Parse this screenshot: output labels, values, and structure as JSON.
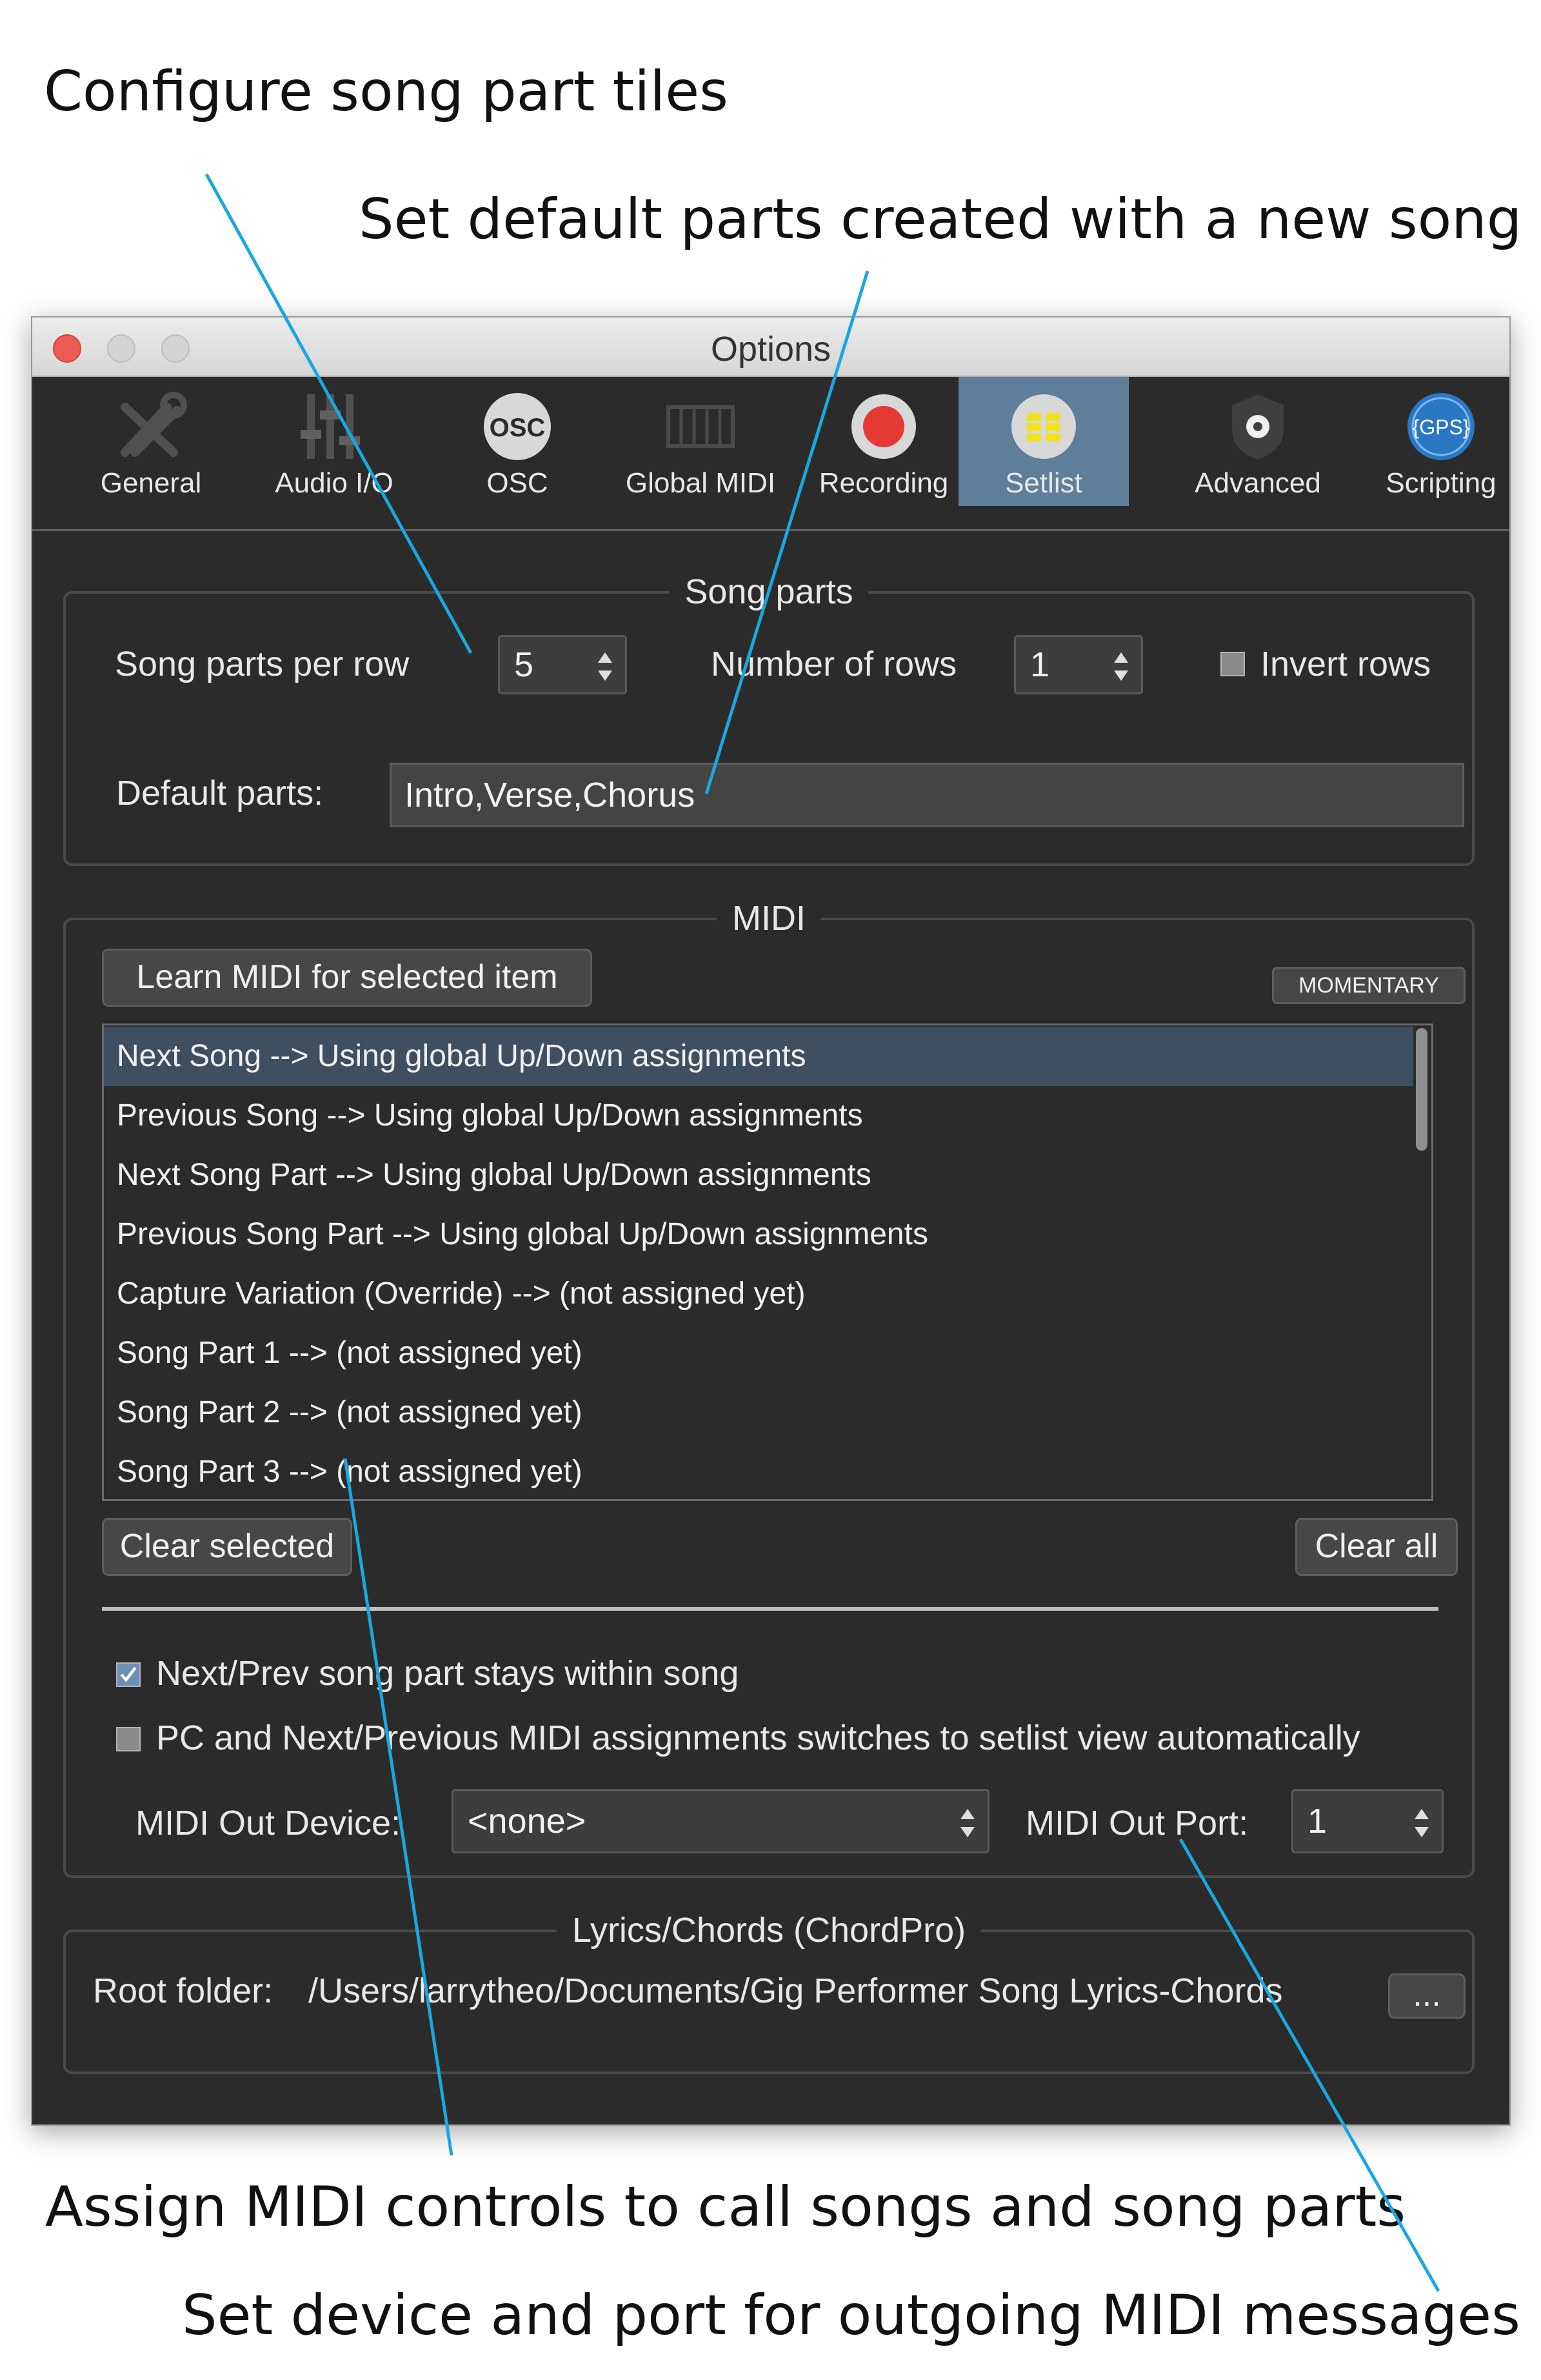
{
  "callouts": {
    "configure": "Configure song part tiles",
    "default_parts": "Set default parts created with a new song",
    "assign_midi": "Assign MIDI controls to call songs and song parts",
    "device_port": "Set device and port for outgoing MIDI messages"
  },
  "window": {
    "title": "Options"
  },
  "tabs": [
    {
      "label": "General",
      "icon": "wrench-screwdriver-icon"
    },
    {
      "label": "Audio I/O",
      "icon": "fader-sliders-icon"
    },
    {
      "label": "OSC",
      "icon": "osc-badge-icon"
    },
    {
      "label": "Global MIDI",
      "icon": "midi-keyboard-icon"
    },
    {
      "label": "Recording",
      "icon": "record-icon"
    },
    {
      "label": "Setlist",
      "icon": "setlist-icon"
    },
    {
      "label": "Advanced",
      "icon": "shield-gear-icon"
    },
    {
      "label": "Scripting",
      "icon": "gps-script-icon"
    }
  ],
  "tabs_osc_text": "OSC",
  "tabs_gps_text": "{GPS}",
  "song_parts": {
    "title": "Song parts",
    "per_row_label": "Song parts per row",
    "per_row_value": "5",
    "rows_label": "Number of rows",
    "rows_value": "1",
    "invert_label": "Invert rows",
    "default_label": "Default parts:",
    "default_value": "Intro,Verse,Chorus"
  },
  "midi": {
    "title": "MIDI",
    "learn_button": "Learn MIDI for selected item",
    "momentary": "MOMENTARY",
    "items": [
      "Next Song --> Using global Up/Down assignments",
      "Previous Song --> Using global Up/Down assignments",
      "Next Song Part --> Using global Up/Down assignments",
      "Previous Song Part --> Using global Up/Down assignments",
      "Capture Variation (Override) --> (not assigned yet)",
      "Song Part 1 --> (not assigned yet)",
      "Song Part 2 --> (not assigned yet)",
      "Song Part 3 --> (not assigned yet)"
    ],
    "clear_selected": "Clear selected",
    "clear_all": "Clear all",
    "stay_within_label": "Next/Prev song part stays within song",
    "switch_view_label": "PC and Next/Previous MIDI assignments switches to setlist view automatically",
    "out_device_label": "MIDI Out Device:",
    "out_device_value": "<none>",
    "out_port_label": "MIDI Out Port:",
    "out_port_value": "1"
  },
  "lyrics": {
    "title": "Lyrics/Chords (ChordPro)",
    "root_label": "Root folder:",
    "root_value": "/Users/larrytheo/Documents/Gig Performer Song Lyrics-Chords",
    "browse_button": "..."
  },
  "colors": {
    "window_bg": "#2b2b2b",
    "active_tab": "#5f7e99",
    "callout_line": "#1aa7e0",
    "record_red": "#e53935",
    "setlist_yellow": "#f1e219"
  }
}
